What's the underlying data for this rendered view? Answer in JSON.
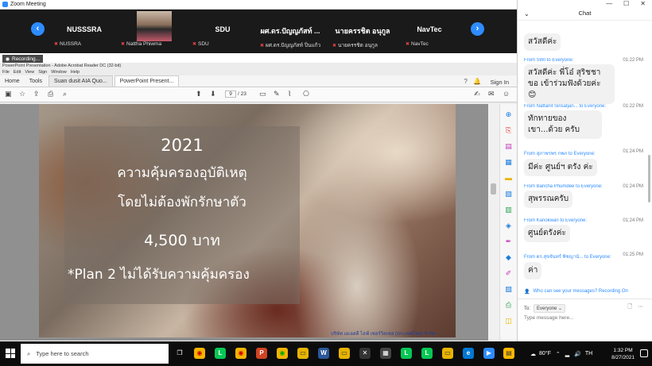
{
  "zoom": {
    "title": "Zoom Meeting"
  },
  "gallery": {
    "prev_label": "‹",
    "next_label": "›",
    "tiles": [
      {
        "name": "NUSSSRA",
        "label": "NUSSRA"
      },
      {
        "name": "",
        "label": "Nattha Phiwma"
      },
      {
        "name": "SDU",
        "label": "SDU"
      },
      {
        "name": "ผศ.ดร.ปัญญภัสท์ ...",
        "label": "ผศ.ดร.ปัญญภัสท์ ปิ่นแก้ว"
      },
      {
        "name": "นายครรชิต อนุกูล",
        "label": "นายครรชิต อนุกูล"
      },
      {
        "name": "NavTec",
        "label": "NavTec"
      }
    ],
    "recording": "Recording..."
  },
  "acrobat": {
    "window_title": "PowerPoint Presentation - Adobe Acrobat Reader DC (32-bit)",
    "menu": [
      "File",
      "Edit",
      "View",
      "Sign",
      "Window",
      "Help"
    ],
    "tabs": {
      "home": "Home",
      "tools": "Tools",
      "doc1": "Suan dusit AIA Quo...",
      "doc2": "PowerPoint Present..."
    },
    "sign_in": "Sign In",
    "page_current": "9",
    "page_total": "/ 23"
  },
  "slide": {
    "year": "2021",
    "line1": "ความคุ้มครองอุบัติเหตุ",
    "line2": "โดยไม่ต้องพักรักษาตัว",
    "price": "4,500 บาท",
    "plan": "*Plan 2 ไม่ได้รับความคุ้มครอง",
    "footer": "บริษัท เอเอสดี ไลฟ์ เซอร์วิสเซส (ประเทศไทย) จำกัด"
  },
  "chat": {
    "title": "Chat",
    "messages": [
      {
        "from": "",
        "time": "",
        "text": "สวัสดีค่ะ"
      },
      {
        "from": "From SWI to Everyone:",
        "time": "01:22 PM",
        "text": "สวัสดีค่ะ พี่โอ๋ สุริชชา ขอ เข้าร่วมฟังด้วยค่ะ 😊"
      },
      {
        "from": "From Nattanit Sirisatjan... to Everyone:",
        "time": "01:22 PM",
        "text": "ทักทายของเขา...ด้วย ครับ"
      },
      {
        "from": "From สุภาพรพร กพภ to Everyone:",
        "time": "01:24 PM",
        "text": "มีค่ะ ศูนย์ฯ ตรัง ค่ะ"
      },
      {
        "from": "From Bancha Phumdee to Everyone:",
        "time": "01:24 PM",
        "text": "สุพรรณครับ"
      },
      {
        "from": "From Kanokwan to Everyone:",
        "time": "01:24 PM",
        "text": "ศูนย์ตรังค่ะ"
      },
      {
        "from": "From ดร.สุขจันทร์ พิชญานั... to Everyone:",
        "time": "01:25 PM",
        "text": "ค่า"
      }
    ],
    "privacy": "Who can see your messages? Recording On",
    "to_label": "To:",
    "to_value": "Everyone",
    "input_placeholder": "Type message here..."
  },
  "taskbar": {
    "search_placeholder": "Type here to search",
    "weather": "80°F",
    "lang": "TH",
    "time": "1:32 PM",
    "date": "8/27/2021"
  },
  "colors": {
    "zoom_blue": "#2d8cff",
    "gallery_bg": "#1a1a1a",
    "taskbar_bg": "#0c0c0c"
  }
}
